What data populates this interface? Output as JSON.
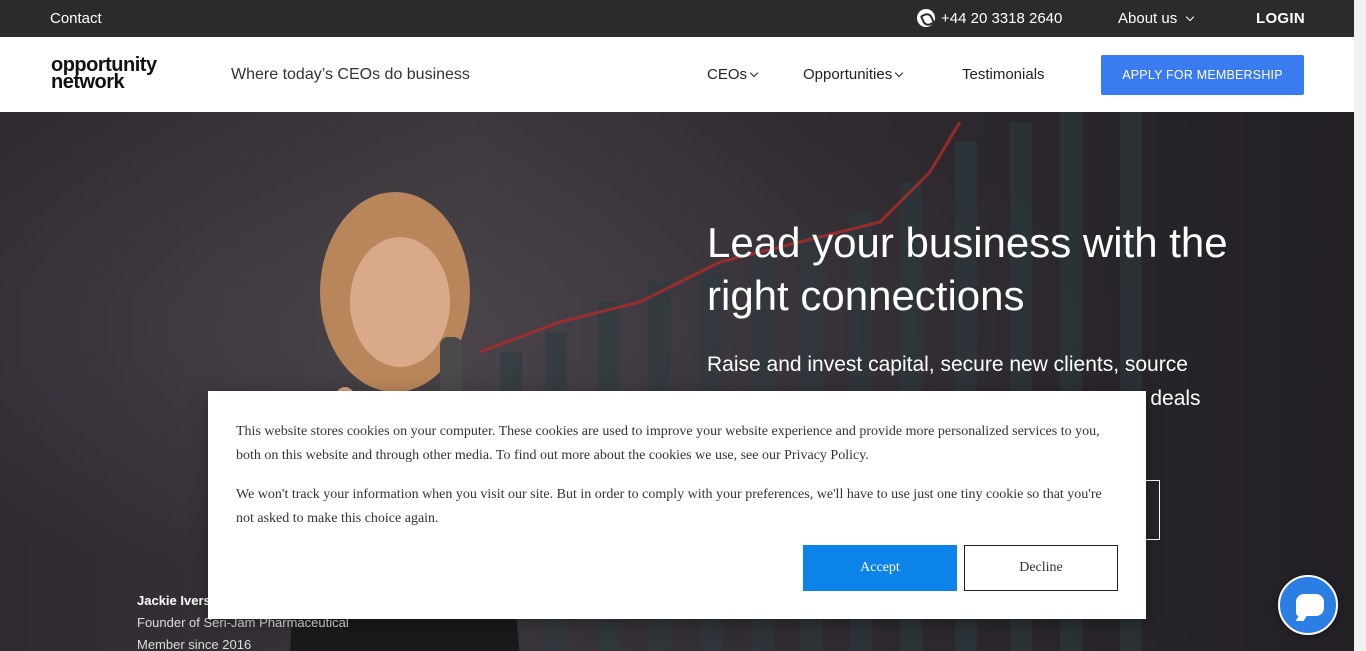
{
  "topbar": {
    "contact": "Contact",
    "phone": "+44 20 3318 2640",
    "about": "About us",
    "login": "LOGIN"
  },
  "navbar": {
    "logo_line1": "opportunity",
    "logo_line2": "network",
    "tagline": "Where today’s CEOs do business",
    "links": [
      "CEOs",
      "Opportunities",
      "Testimonials"
    ],
    "apply": "APPLY FOR MEMBERSHIP"
  },
  "hero": {
    "headline": "Lead your business with the right connections",
    "subline": "Raise and invest capital, secure new clients, source",
    "subline_visible_fragment": "te deals",
    "member": {
      "name": "Jackie Ivers",
      "role": "Founder of Seri-Jam Pharmaceutical",
      "since": "Member since 2016"
    }
  },
  "cookie": {
    "text1": "This website stores cookies on your computer. These cookies are used to improve your website experience and provide more personalized services to you, both on this website and through other media. To find out more about the cookies we use, see our Privacy Policy.",
    "text2": "We won't track your information when you visit our site. But in order to comply with your preferences, we'll have to use just one tiny cookie so that you're not asked to make this choice again.",
    "accept": "Accept",
    "decline": "Decline"
  },
  "icons": {
    "whatsapp": "whatsapp-icon",
    "chat": "chat-icon"
  },
  "colors": {
    "topbar": "#2b2b2d",
    "apply_button": "#3a7bef",
    "accept_button": "#0b83e9",
    "chat_button": "#2b7ee3"
  }
}
